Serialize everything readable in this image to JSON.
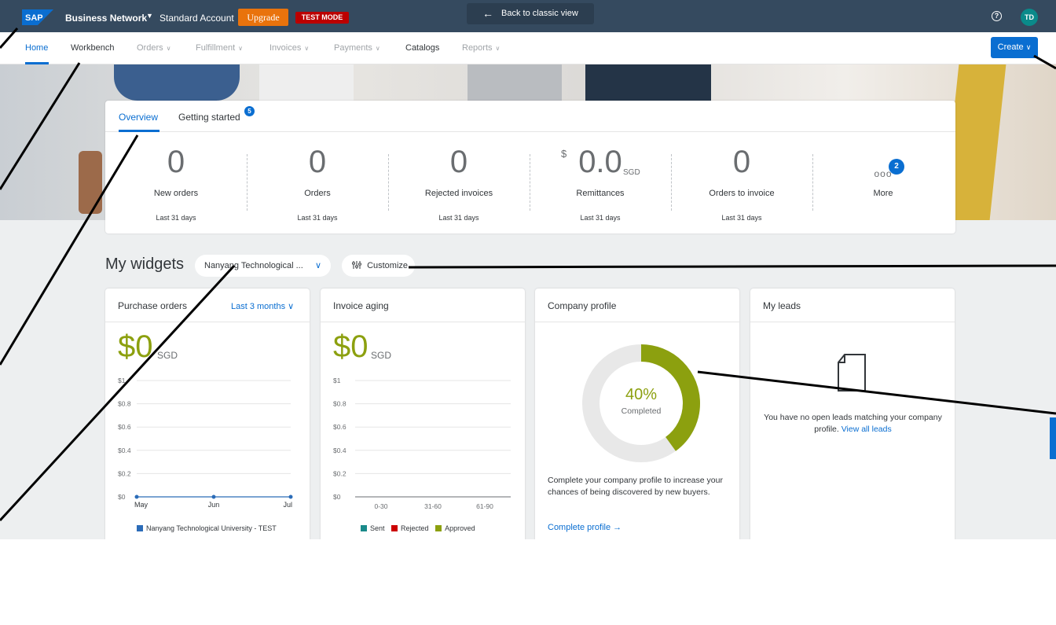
{
  "shell": {
    "logo_text": "SAP",
    "app_name": "Business Network",
    "app_caret": "▼",
    "account": "Standard Account",
    "upgrade_label": "Upgrade",
    "test_mode_label": "TEST MODE",
    "back_label": "Back to classic view",
    "back_icon": "←",
    "help_icon": "?",
    "avatar_initials": "TD",
    "colors": {
      "bar": "#354a5f",
      "upgrade": "#e9730c",
      "test_mode": "#bb0000",
      "avatar": "#0a8a8a"
    }
  },
  "nav": {
    "items": [
      {
        "label": "Home",
        "active": true
      },
      {
        "label": "Workbench"
      },
      {
        "label": "Orders",
        "chevron": "∨"
      },
      {
        "label": "Fulfillment",
        "chevron": "∨"
      },
      {
        "label": "Invoices",
        "chevron": "∨"
      },
      {
        "label": "Payments",
        "chevron": "∨"
      },
      {
        "label": "Catalogs"
      },
      {
        "label": "Reports",
        "chevron": "∨"
      }
    ],
    "create_label": "Create",
    "create_chevron": "∨",
    "accent": "#0a6ed1"
  },
  "overview": {
    "tabs": [
      {
        "label": "Overview"
      },
      {
        "label": "Getting started"
      }
    ],
    "getting_started_badge": "5",
    "metrics": [
      {
        "value": "0",
        "label": "New orders",
        "period": "Last 31 days"
      },
      {
        "value": "0",
        "label": "Orders",
        "period": "Last 31 days"
      },
      {
        "value": "0",
        "label": "Rejected invoices",
        "period": "Last 31 days"
      },
      {
        "value": "0.0",
        "currency_prefix": "$",
        "currency_suffix": "SGD",
        "label": "Remittances",
        "period": "Last 31 days"
      },
      {
        "value": "0",
        "label": "Orders to invoice",
        "period": "Last 31 days"
      }
    ],
    "more": {
      "label": "More",
      "dots": "ooo",
      "badge": "2"
    }
  },
  "widgets": {
    "title": "My widgets",
    "org_select": "Nanyang Technological ...",
    "org_select_chevron": "∨",
    "customize_label": "Customize",
    "customize_icon": "sliders-icon",
    "purchase_orders": {
      "title": "Purchase orders",
      "range": "Last 3 months",
      "range_chevron": "∨",
      "value": "$0",
      "currency": "SGD",
      "legend": "Nanyang Technological University - TEST"
    },
    "invoice_aging": {
      "title": "Invoice aging",
      "value": "$0",
      "currency": "SGD",
      "legend": [
        {
          "label": "Sent",
          "color": "#1a8a8a"
        },
        {
          "label": "Rejected",
          "color": "#cc0000"
        },
        {
          "label": "Approved",
          "color": "#8ca00f"
        }
      ]
    },
    "company_profile": {
      "title": "Company profile",
      "percent_label": "40%",
      "completed_label": "Completed",
      "percent_value": 40,
      "ring_color": "#8ca00f",
      "ring_track": "#e8e8e8",
      "text": "Complete your company profile to increase your chances of being discovered by new buyers.",
      "link": "Complete profile",
      "link_icon": "→"
    },
    "my_leads": {
      "title": "My leads",
      "text": "You have no open leads matching your company profile.",
      "link": "View all leads",
      "icon": "document-icon"
    }
  },
  "chart_data": [
    {
      "type": "line",
      "title": "Purchase orders",
      "categories": [
        "May",
        "Jun",
        "Jul"
      ],
      "series": [
        {
          "name": "Nanyang Technological University - TEST",
          "values": [
            0,
            0,
            0
          ],
          "color": "#2b6cb8"
        }
      ],
      "y_ticks": [
        "$0",
        "$0.2",
        "$0.4",
        "$0.6",
        "$0.8",
        "$1"
      ],
      "ylim": [
        0,
        1
      ],
      "grid": true,
      "legend": "bottom"
    },
    {
      "type": "bar",
      "title": "Invoice aging",
      "categories": [
        "0-30",
        "31-60",
        "61-90"
      ],
      "series": [
        {
          "name": "Sent",
          "values": [
            0,
            0,
            0
          ],
          "color": "#1a8a8a"
        },
        {
          "name": "Rejected",
          "values": [
            0,
            0,
            0
          ],
          "color": "#cc0000"
        },
        {
          "name": "Approved",
          "values": [
            0,
            0,
            0
          ],
          "color": "#8ca00f"
        }
      ],
      "y_ticks": [
        "$0",
        "$0.2",
        "$0.4",
        "$0.6",
        "$0.8",
        "$1"
      ],
      "ylim": [
        0,
        1
      ],
      "grid": true,
      "legend": "bottom"
    },
    {
      "type": "pie",
      "title": "Company profile",
      "categories": [
        "Completed",
        "Remaining"
      ],
      "values": [
        40,
        60
      ]
    }
  ]
}
